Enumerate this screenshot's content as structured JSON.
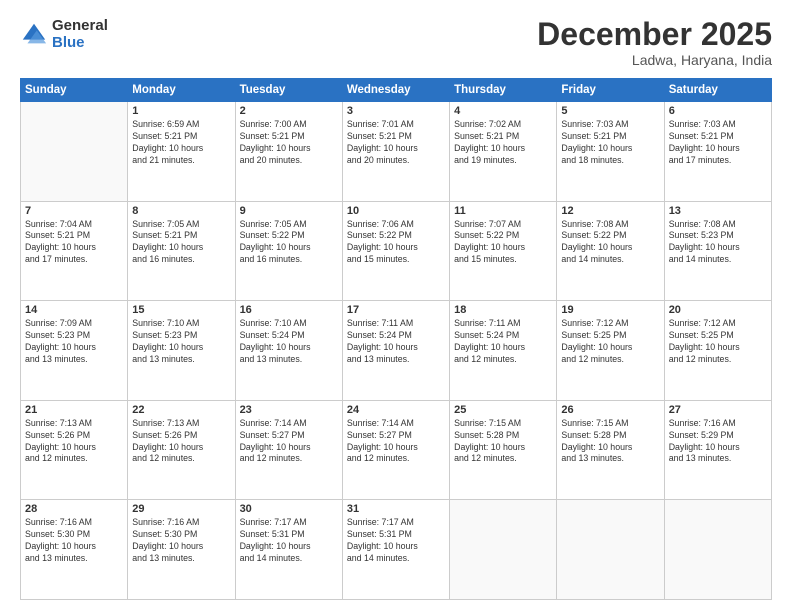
{
  "header": {
    "logo_general": "General",
    "logo_blue": "Blue",
    "month_title": "December 2025",
    "location": "Ladwa, Haryana, India"
  },
  "days_of_week": [
    "Sunday",
    "Monday",
    "Tuesday",
    "Wednesday",
    "Thursday",
    "Friday",
    "Saturday"
  ],
  "weeks": [
    [
      {
        "day": "",
        "info": ""
      },
      {
        "day": "1",
        "info": "Sunrise: 6:59 AM\nSunset: 5:21 PM\nDaylight: 10 hours\nand 21 minutes."
      },
      {
        "day": "2",
        "info": "Sunrise: 7:00 AM\nSunset: 5:21 PM\nDaylight: 10 hours\nand 20 minutes."
      },
      {
        "day": "3",
        "info": "Sunrise: 7:01 AM\nSunset: 5:21 PM\nDaylight: 10 hours\nand 20 minutes."
      },
      {
        "day": "4",
        "info": "Sunrise: 7:02 AM\nSunset: 5:21 PM\nDaylight: 10 hours\nand 19 minutes."
      },
      {
        "day": "5",
        "info": "Sunrise: 7:03 AM\nSunset: 5:21 PM\nDaylight: 10 hours\nand 18 minutes."
      },
      {
        "day": "6",
        "info": "Sunrise: 7:03 AM\nSunset: 5:21 PM\nDaylight: 10 hours\nand 17 minutes."
      }
    ],
    [
      {
        "day": "7",
        "info": "Sunrise: 7:04 AM\nSunset: 5:21 PM\nDaylight: 10 hours\nand 17 minutes."
      },
      {
        "day": "8",
        "info": "Sunrise: 7:05 AM\nSunset: 5:21 PM\nDaylight: 10 hours\nand 16 minutes."
      },
      {
        "day": "9",
        "info": "Sunrise: 7:05 AM\nSunset: 5:22 PM\nDaylight: 10 hours\nand 16 minutes."
      },
      {
        "day": "10",
        "info": "Sunrise: 7:06 AM\nSunset: 5:22 PM\nDaylight: 10 hours\nand 15 minutes."
      },
      {
        "day": "11",
        "info": "Sunrise: 7:07 AM\nSunset: 5:22 PM\nDaylight: 10 hours\nand 15 minutes."
      },
      {
        "day": "12",
        "info": "Sunrise: 7:08 AM\nSunset: 5:22 PM\nDaylight: 10 hours\nand 14 minutes."
      },
      {
        "day": "13",
        "info": "Sunrise: 7:08 AM\nSunset: 5:23 PM\nDaylight: 10 hours\nand 14 minutes."
      }
    ],
    [
      {
        "day": "14",
        "info": "Sunrise: 7:09 AM\nSunset: 5:23 PM\nDaylight: 10 hours\nand 13 minutes."
      },
      {
        "day": "15",
        "info": "Sunrise: 7:10 AM\nSunset: 5:23 PM\nDaylight: 10 hours\nand 13 minutes."
      },
      {
        "day": "16",
        "info": "Sunrise: 7:10 AM\nSunset: 5:24 PM\nDaylight: 10 hours\nand 13 minutes."
      },
      {
        "day": "17",
        "info": "Sunrise: 7:11 AM\nSunset: 5:24 PM\nDaylight: 10 hours\nand 13 minutes."
      },
      {
        "day": "18",
        "info": "Sunrise: 7:11 AM\nSunset: 5:24 PM\nDaylight: 10 hours\nand 12 minutes."
      },
      {
        "day": "19",
        "info": "Sunrise: 7:12 AM\nSunset: 5:25 PM\nDaylight: 10 hours\nand 12 minutes."
      },
      {
        "day": "20",
        "info": "Sunrise: 7:12 AM\nSunset: 5:25 PM\nDaylight: 10 hours\nand 12 minutes."
      }
    ],
    [
      {
        "day": "21",
        "info": "Sunrise: 7:13 AM\nSunset: 5:26 PM\nDaylight: 10 hours\nand 12 minutes."
      },
      {
        "day": "22",
        "info": "Sunrise: 7:13 AM\nSunset: 5:26 PM\nDaylight: 10 hours\nand 12 minutes."
      },
      {
        "day": "23",
        "info": "Sunrise: 7:14 AM\nSunset: 5:27 PM\nDaylight: 10 hours\nand 12 minutes."
      },
      {
        "day": "24",
        "info": "Sunrise: 7:14 AM\nSunset: 5:27 PM\nDaylight: 10 hours\nand 12 minutes."
      },
      {
        "day": "25",
        "info": "Sunrise: 7:15 AM\nSunset: 5:28 PM\nDaylight: 10 hours\nand 12 minutes."
      },
      {
        "day": "26",
        "info": "Sunrise: 7:15 AM\nSunset: 5:28 PM\nDaylight: 10 hours\nand 13 minutes."
      },
      {
        "day": "27",
        "info": "Sunrise: 7:16 AM\nSunset: 5:29 PM\nDaylight: 10 hours\nand 13 minutes."
      }
    ],
    [
      {
        "day": "28",
        "info": "Sunrise: 7:16 AM\nSunset: 5:30 PM\nDaylight: 10 hours\nand 13 minutes."
      },
      {
        "day": "29",
        "info": "Sunrise: 7:16 AM\nSunset: 5:30 PM\nDaylight: 10 hours\nand 13 minutes."
      },
      {
        "day": "30",
        "info": "Sunrise: 7:17 AM\nSunset: 5:31 PM\nDaylight: 10 hours\nand 14 minutes."
      },
      {
        "day": "31",
        "info": "Sunrise: 7:17 AM\nSunset: 5:31 PM\nDaylight: 10 hours\nand 14 minutes."
      },
      {
        "day": "",
        "info": ""
      },
      {
        "day": "",
        "info": ""
      },
      {
        "day": "",
        "info": ""
      }
    ]
  ]
}
